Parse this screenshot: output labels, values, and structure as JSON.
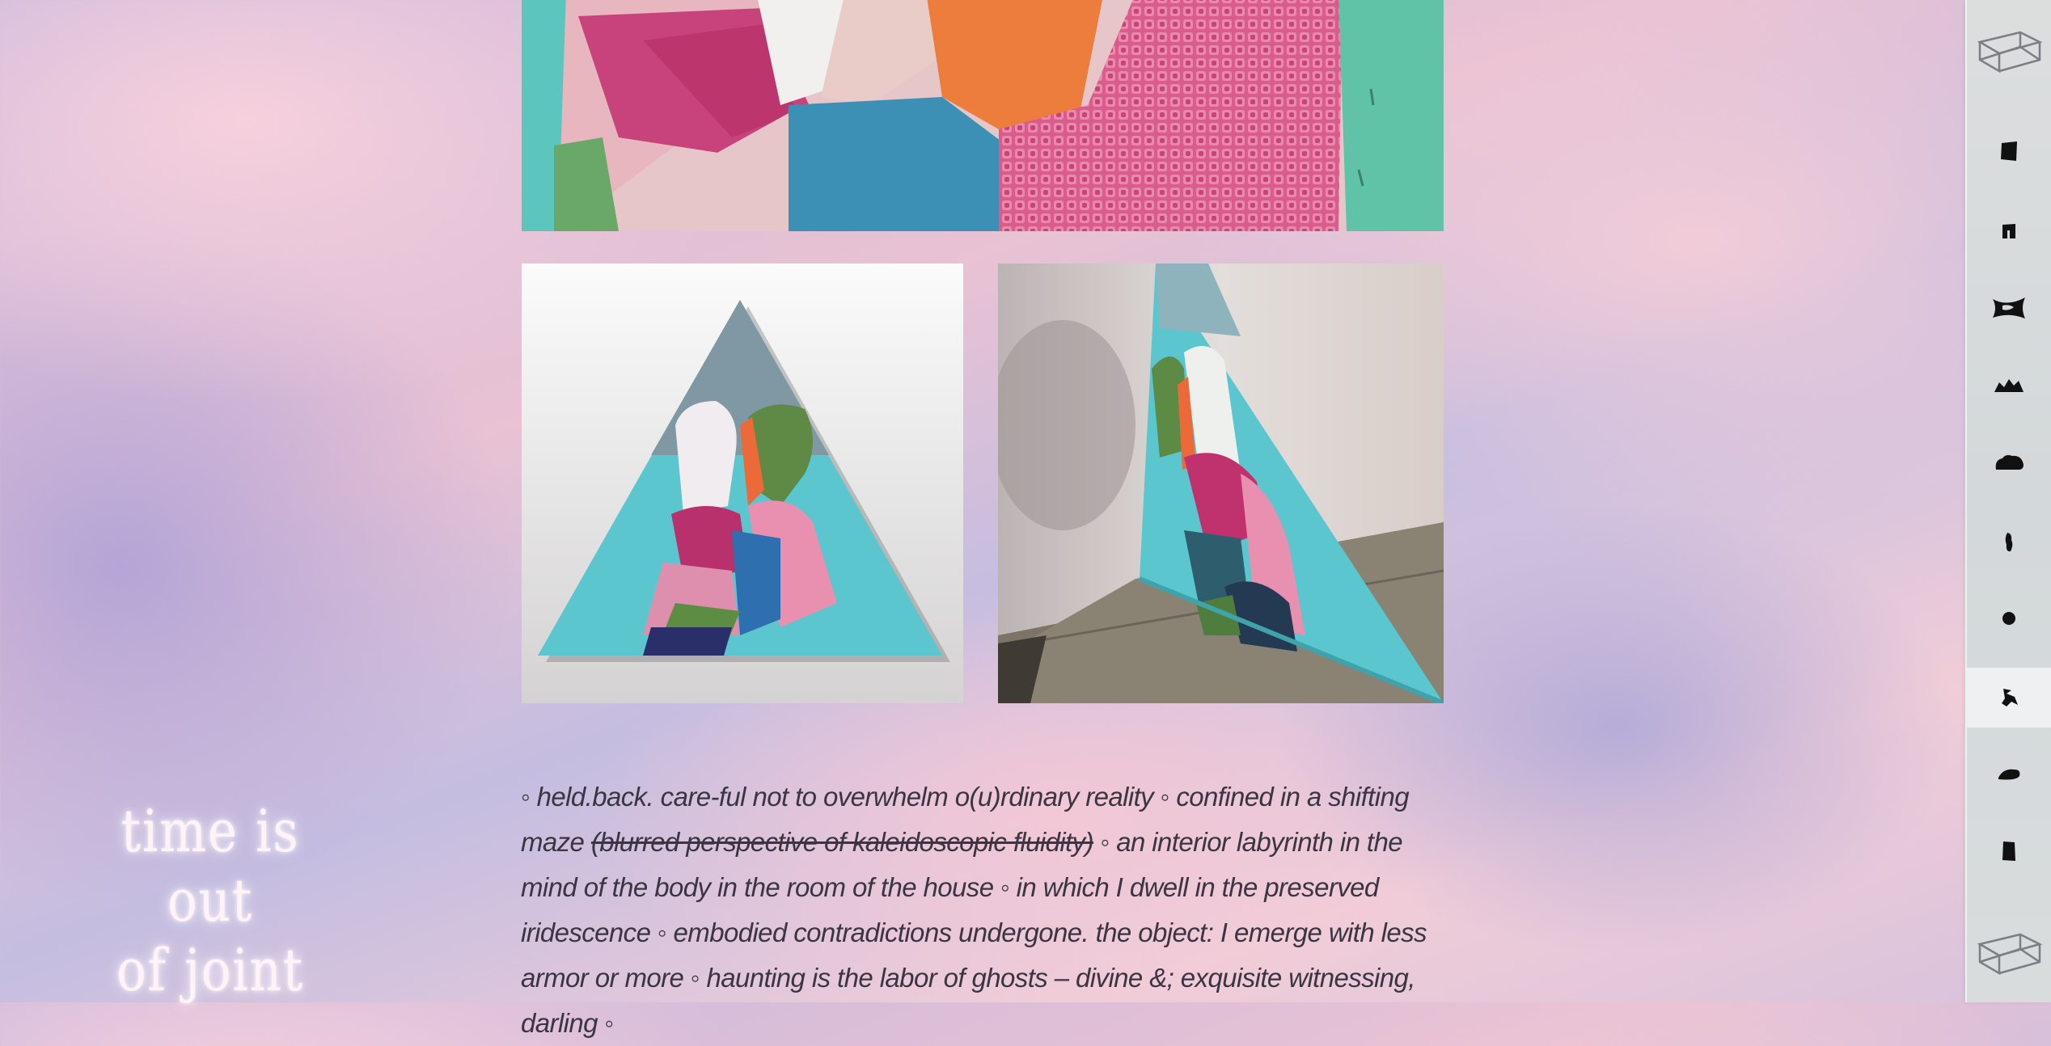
{
  "gallery": {
    "top_image": "textile-patchwork-closeup",
    "left_image": "triangle-textile-artwork-front",
    "right_image": "triangle-textile-artwork-side"
  },
  "poem": {
    "part1": "◦ held.back. care-ful not to overwhelm o(u)rdinary reality ◦ confined in a shifting maze ",
    "strike": "(blurred perspective of kaleidoscopic fluidity)",
    "part2": " ◦ an interior labyrinth in the mind of the body in the room of the house ◦ in which I dwell in the preserved iridescence ◦ embodied contradictions undergone. the object: I emerge with less armor or more ◦ haunting is the labor of ghosts – divine &; exquisite witnessing, darling ◦"
  },
  "motto": {
    "line1": "time is out",
    "line2": "of joint"
  },
  "sidebar": {
    "top_icon": "wireframe-cube-icon",
    "bottom_icon": "wireframe-cube-icon",
    "items": [
      {
        "icon": "shape-1-icon"
      },
      {
        "icon": "shape-2-icon"
      },
      {
        "icon": "shape-3-icon"
      },
      {
        "icon": "shape-4-icon"
      },
      {
        "icon": "shape-5-icon"
      },
      {
        "icon": "shape-6-icon"
      },
      {
        "icon": "shape-7-icon"
      },
      {
        "icon": "shape-8-icon",
        "active": true
      },
      {
        "icon": "shape-9-icon"
      },
      {
        "icon": "shape-10-icon"
      }
    ]
  },
  "colors": {
    "sky_pink": "#f0cdd8",
    "sky_lilac": "#c9b9de",
    "text": "#3b3442",
    "turquoise": "#5cc6cf"
  }
}
